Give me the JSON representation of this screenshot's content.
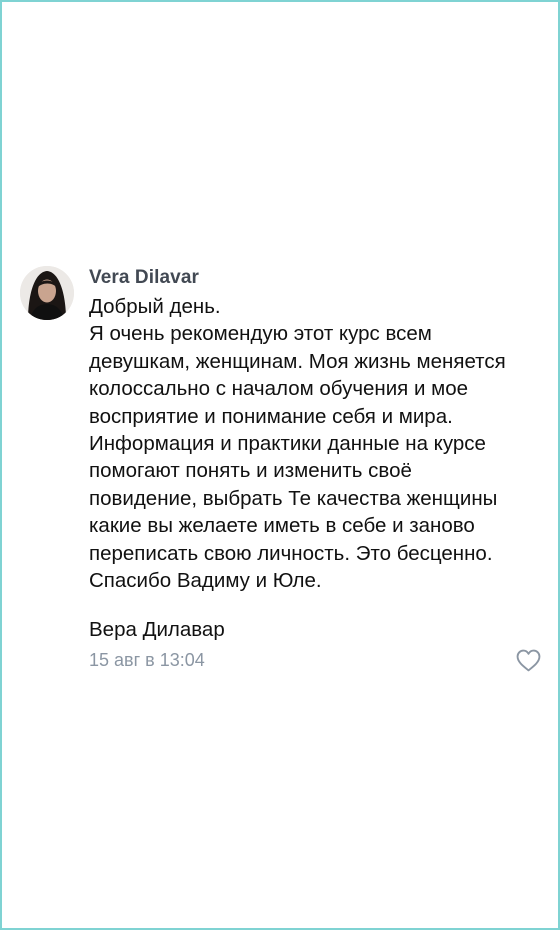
{
  "comment": {
    "author": "Vera Dilavar",
    "avatar_icon": "user-avatar-photo",
    "lines": [
      "Добрый день.",
      "Я очень рекомендую этот курс всем",
      "девушкам, женщинам. Моя жизнь меняется",
      "колоссально с началом обучения и мое",
      "восприятие и понимание себя и мира.",
      "Информация и практики данные на курсе",
      "помогают понять и изменить своё",
      "повидение, выбрать Те качества женщины",
      "какие вы желаете иметь в себе и заново",
      "переписать свою личность. Это бесценно.",
      "Спасибо Вадиму и Юле."
    ],
    "signature": "Вера Дилавар",
    "timestamp": "15 авг в 13:04",
    "like_icon": "heart-icon"
  },
  "colors": {
    "frame_border": "#7fd3d3",
    "author": "#424953",
    "meta": "#8b96a3",
    "text": "#111111"
  }
}
